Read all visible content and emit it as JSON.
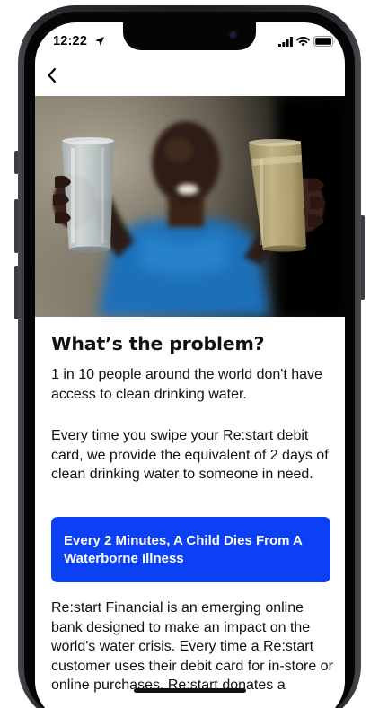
{
  "status_bar": {
    "time": "12:22"
  },
  "navigation": {
    "back_icon": "chevron-left-icon"
  },
  "content": {
    "title": "What’s the problem?",
    "paragraph_1": "1 in 10 people around the world don't have access to clean drinking water.",
    "paragraph_2": "Every time you swipe your Re:start debit card, we provide the equivalent of 2 days of clean drinking water to someone in need.",
    "cta_label": "Every 2 Minutes, A Child Dies From A Waterborne Illness",
    "paragraph_3": "Re:start Financial is an emerging online bank designed to make an impact on the world's water crisis. Every time a Re:start customer uses their debit card for in-store or online purchases, Re:start donates a"
  },
  "colors": {
    "cta_background": "#0b40f5",
    "text": "#111111",
    "background": "#ffffff"
  }
}
